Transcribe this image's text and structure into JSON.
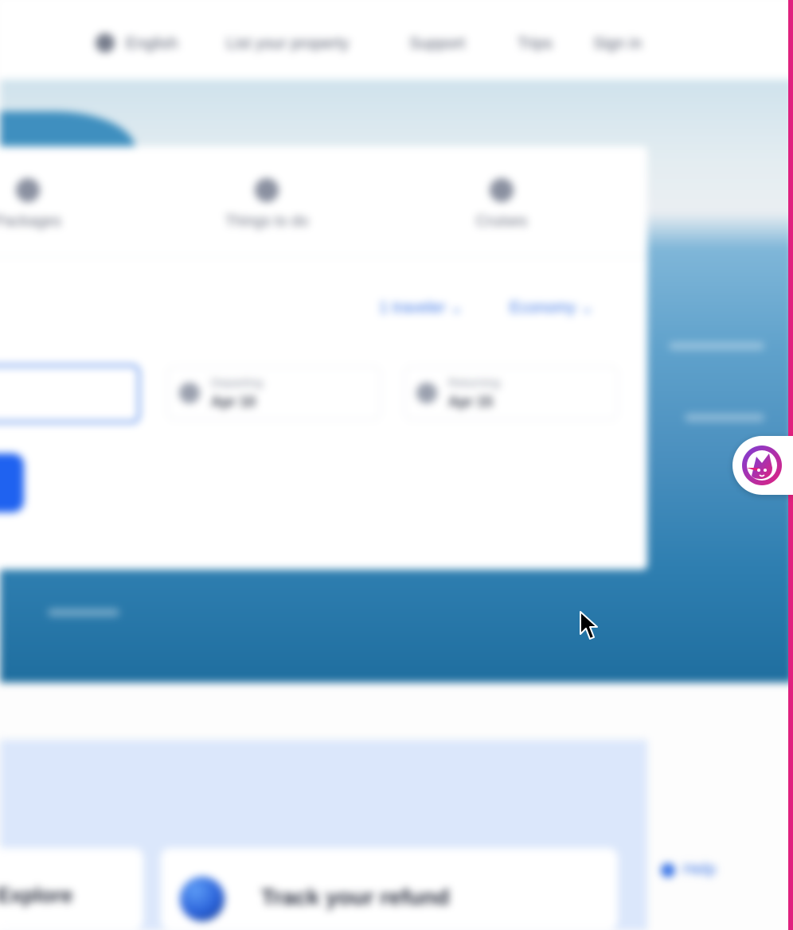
{
  "topnav": {
    "items": [
      "English",
      "List your property",
      "Support",
      "Trips",
      "Sign in"
    ]
  },
  "search": {
    "tabs": [
      "Packages",
      "Things to do",
      "Cruises"
    ],
    "dropdowns": [
      "1 traveler",
      "Economy"
    ],
    "date_fields": [
      {
        "label": "Departing",
        "value": "Apr 10"
      },
      {
        "label": "Returning",
        "value": "Apr 15"
      }
    ]
  },
  "promo": {
    "left_title": "Explore",
    "card_title": "Track your refund",
    "help_label": "Help"
  },
  "colors": {
    "accent": "#1f62f0",
    "link": "#3d77e6",
    "extension_border": "#e0217e"
  },
  "icons": {
    "extension": "cat-extension-icon",
    "cursor": "mouse-cursor-icon"
  }
}
